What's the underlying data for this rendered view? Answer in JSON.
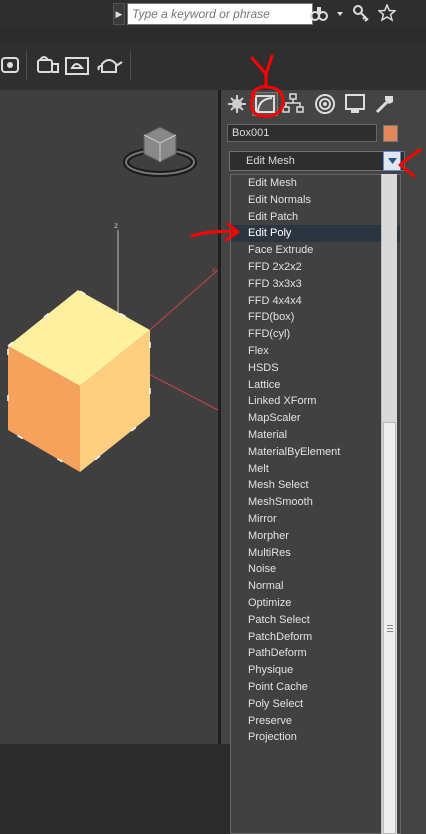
{
  "search": {
    "placeholder": "Type a keyword or phrase"
  },
  "top_icons": [
    "binoculars-icon",
    "dropdown-arrow-icon",
    "key-icon",
    "star-icon"
  ],
  "toolbar_icons": [
    "render-setup-icon",
    "rendered-frame-window-icon",
    "render-production-icon",
    "render-teapot-icon"
  ],
  "command_panel": {
    "tabs": [
      "create-tab-icon",
      "modify-tab-icon",
      "hierarchy-tab-icon",
      "motion-tab-icon",
      "display-tab-icon",
      "utilities-tab-icon"
    ],
    "object_name": "Box001",
    "object_color": "#e0895a",
    "modifier_list_selected": "Edit Mesh",
    "modifier_list_items": [
      "Edit Mesh",
      "Edit Normals",
      "Edit Patch",
      "Edit Poly",
      "Face Extrude",
      "FFD 2x2x2",
      "FFD 3x3x3",
      "FFD 4x4x4",
      "FFD(box)",
      "FFD(cyl)",
      "Flex",
      "HSDS",
      "Lattice",
      "Linked XForm",
      "MapScaler",
      "Material",
      "MaterialByElement",
      "Melt",
      "Mesh Select",
      "MeshSmooth",
      "Mirror",
      "Morpher",
      "MultiRes",
      "Noise",
      "Normal",
      "Optimize",
      "Patch Select",
      "PatchDeform",
      "PathDeform",
      "Physique",
      "Point Cache",
      "Poly Select",
      "Preserve",
      "Projection"
    ],
    "highlighted_item": "Edit Poly"
  },
  "viewport": {
    "axis_label_z": "z",
    "axis_label_x": "x",
    "box_colors": {
      "top": "#fff0a0",
      "left": "#f7a25c",
      "right": "#ffcf80"
    }
  },
  "annotation_color": "#ff0000"
}
